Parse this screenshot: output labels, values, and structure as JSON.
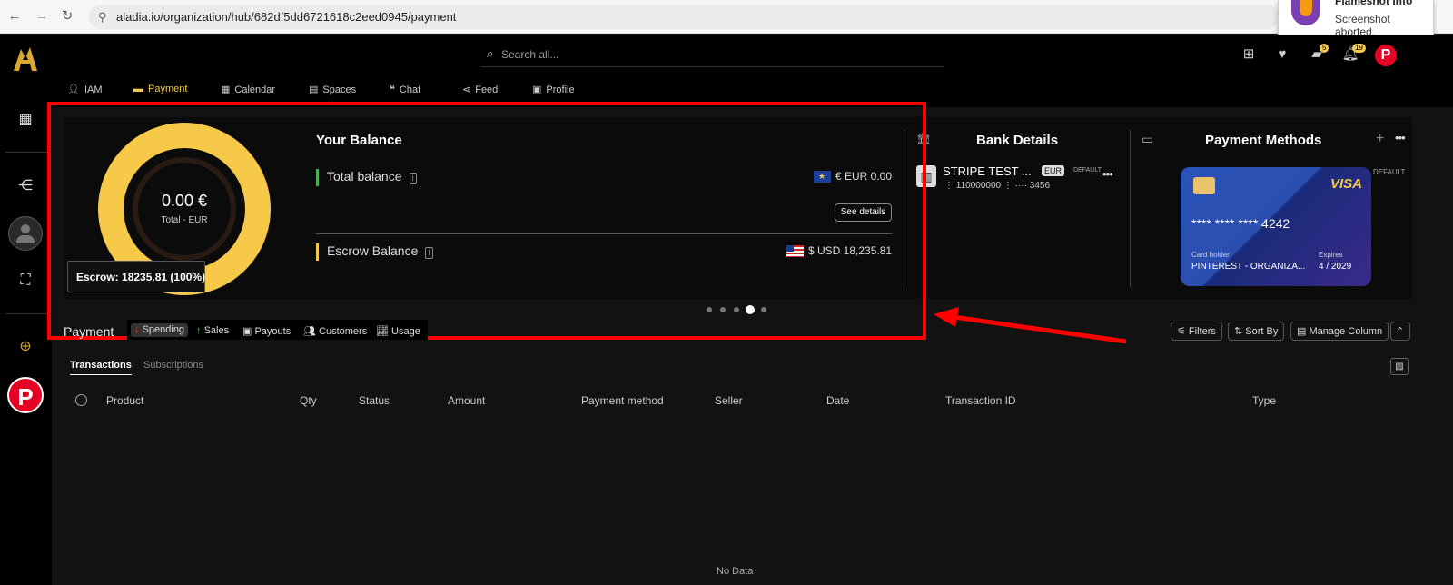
{
  "browser": {
    "url": "aladia.io/organization/hub/682df5dd6721618c2eed0945/payment",
    "back_icon": "arrow-left-icon",
    "forward_icon": "arrow-right-icon",
    "reload_icon": "reload-icon",
    "notification": {
      "title": "Flameshot Info",
      "body": "Screenshot aborted."
    }
  },
  "header": {
    "search_placeholder": "Search all...",
    "messages_badge": "5",
    "notifications_badge": "19",
    "avatar_letter": "P"
  },
  "nav_tabs": [
    {
      "label": "IAM",
      "icon": "user-icon"
    },
    {
      "label": "Payment",
      "icon": "wallet-icon",
      "active": true
    },
    {
      "label": "Calendar",
      "icon": "calendar-icon"
    },
    {
      "label": "Spaces",
      "icon": "spaces-icon"
    },
    {
      "label": "Chat",
      "icon": "chat-icon"
    },
    {
      "label": "Feed",
      "icon": "share-icon"
    },
    {
      "label": "Profile",
      "icon": "id-card-icon"
    }
  ],
  "balance": {
    "donut_amount": "0.00 €",
    "donut_label": "Total - EUR",
    "tooltip": "Escrow: 18235.81 (100%)",
    "title": "Your Balance",
    "total_label": "Total balance",
    "total_amount": "€ EUR 0.00",
    "see_details": "See details",
    "escrow_label": "Escrow Balance",
    "escrow_amount": "$ USD 18,235.81",
    "escrow_share": 1.0
  },
  "bank": {
    "title": "Bank Details",
    "name": "STRIPE TEST ...",
    "currency": "EUR",
    "default": "DEFAULT",
    "number": "110000000",
    "last4": "···· 3456"
  },
  "payment_methods": {
    "title": "Payment Methods",
    "brand": "VISA",
    "card_number": "**** **** **** 4242",
    "holder_label": "Card holder",
    "holder": "PINTEREST - ORGANIZA...",
    "expires_label": "Expires",
    "expires": "4 / 2029",
    "default": "DEFAULT"
  },
  "carousel": {
    "count": 5,
    "active_index": 3
  },
  "payment_section": {
    "label": "Payment",
    "subtabs": [
      "Spending",
      "Sales",
      "Payouts",
      "Customers",
      "Usage"
    ],
    "filters": "Filters",
    "sort_by": "Sort By",
    "manage_column": "Manage Column"
  },
  "table": {
    "tabs": [
      "Transactions",
      "Subscriptions"
    ],
    "columns": [
      "Product",
      "Qty",
      "Status",
      "Amount",
      "Payment method",
      "Seller",
      "Date",
      "Transaction ID",
      "Type"
    ],
    "empty_text": "No Data"
  },
  "colors": {
    "accent": "#f7c948",
    "highlight": "#ff0000",
    "pinterest": "#e60023"
  }
}
